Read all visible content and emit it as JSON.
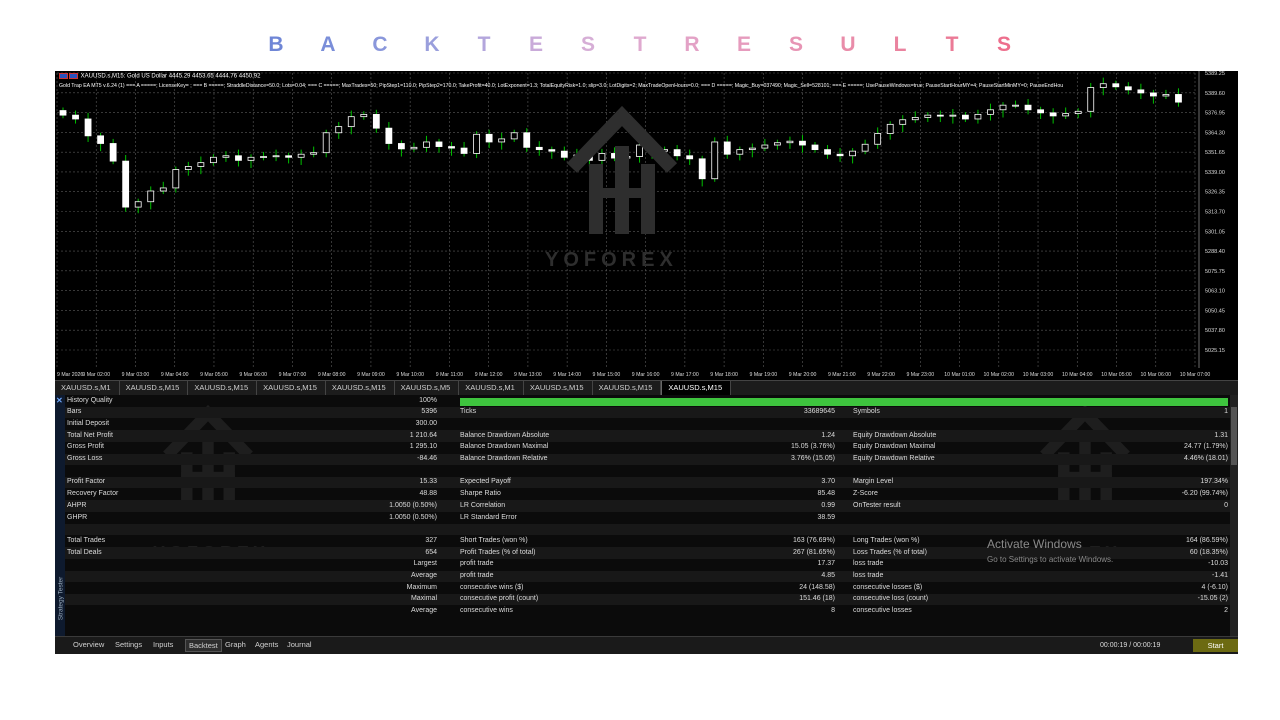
{
  "page_title_letters": [
    "B",
    "A",
    "C",
    "K",
    "T",
    "E",
    "S",
    "T",
    "R",
    "E",
    "S",
    "U",
    "L",
    "T",
    "S"
  ],
  "page_title_colors": [
    "#6f86d6",
    "#7a8ed9",
    "#8a97db",
    "#9a9fdc",
    "#b3a6dc",
    "#c9aad9",
    "#d6aed6",
    "#dfa9cf",
    "#e3a2c6",
    "#e69bbd",
    "#e794b4",
    "#e98ca9",
    "#ea839f",
    "#eb7a96",
    "#ed6f8d"
  ],
  "chart": {
    "symbol_line": "XAUUSD.s,M15:  Gold US Dollar  4445.29 4453.65 4444.76 4450.92",
    "params_line": "Gold Trap EA MT5 v.6.24 (1)  ===  A  =====; LicenseKey= ; ===  B  =====; StraddleDistance=50.0; Lots=0.04; ===  C  =====; MaxTrades=50; PipStep1=110.0; PipStep2=170.0; TakeProfit=40.0; LotExponent=1.3; TotalEquityRisk=1.0; slip=3.0; LotDigits=2; MaxTradeOpenHours=0.0; ===  D  =====; Magic_Buy=037490; Magic_Sell=528101; ===  E  =====; UsePauseWindows=true; PauseStartHourMY=4; PauseStartMinMY=0; PauseEndHou",
    "watermark": "YOFOREX",
    "price_labels": [
      "5389.25",
      "5389.60",
      "5376.95",
      "5364.30",
      "5351.65",
      "5339.00",
      "5326.35",
      "5313.70",
      "5301.05",
      "5288.40",
      "5075.75",
      "5063.10",
      "5050.45",
      "5037.80",
      "5025.15"
    ],
    "time_labels": [
      "9 Mar 2026",
      "9 Mar 02:00",
      "9 Mar 03:00",
      "9 Mar 04:00",
      "9 Mar 05:00",
      "9 Mar 06:00",
      "9 Mar 07:00",
      "9 Mar 08:00",
      "9 Mar 09:00",
      "9 Mar 10:00",
      "9 Mar 11:00",
      "9 Mar 12:00",
      "9 Mar 13:00",
      "9 Mar 14:00",
      "9 Mar 15:00",
      "9 Mar 16:00",
      "9 Mar 17:00",
      "9 Mar 18:00",
      "9 Mar 19:00",
      "9 Mar 20:00",
      "9 Mar 21:00",
      "9 Mar 22:00",
      "9 Mar 23:00",
      "10 Mar 01:00",
      "10 Mar 02:00",
      "10 Mar 03:00",
      "10 Mar 04:00",
      "10 Mar 05:00",
      "10 Mar 06:00",
      "10 Mar 07:00"
    ],
    "closes": [
      5345,
      5340,
      5318,
      5308,
      5285,
      5225,
      5232,
      5246,
      5250,
      5274,
      5278,
      5283,
      5290,
      5292,
      5286,
      5290,
      5291,
      5292,
      5290,
      5294,
      5296,
      5322,
      5330,
      5343,
      5346,
      5328,
      5308,
      5301,
      5303,
      5310,
      5304,
      5302,
      5295,
      5320,
      5310,
      5314,
      5322,
      5303,
      5300,
      5298,
      5290,
      5293,
      5286,
      5295,
      5289,
      5291,
      5306,
      5298,
      5300,
      5292,
      5288,
      5262,
      5310,
      5294,
      5300,
      5302,
      5306,
      5309,
      5311,
      5306,
      5300,
      5294,
      5292,
      5298,
      5307,
      5321,
      5333,
      5339,
      5342,
      5345,
      5344,
      5345,
      5340,
      5346,
      5352,
      5358,
      5358,
      5352,
      5348,
      5344,
      5347,
      5350,
      5381,
      5386,
      5382,
      5378,
      5374,
      5370,
      5372,
      5362
    ]
  },
  "chart_tabs": [
    "XAUUSD.s,M1",
    "XAUUSD.s,M15",
    "XAUUSD.s,M15",
    "XAUUSD.s,M15",
    "XAUUSD.s,M15",
    "XAUUSD.s,M5",
    "XAUUSD.s,M1",
    "XAUUSD.s,M15",
    "XAUUSD.s,M15",
    "XAUUSD.s,M15"
  ],
  "report": {
    "rows": [
      {
        "l1": "History Quality",
        "v1": "100%",
        "l2": "",
        "v2": "",
        "l3": "",
        "v3": ""
      },
      {
        "l1": "Bars",
        "v1": "5396",
        "l2": "Ticks",
        "v2": "33689645",
        "l3": "Symbols",
        "v3": "1"
      },
      {
        "l1": "Initial Deposit",
        "v1": "300.00",
        "l2": "",
        "v2": "",
        "l3": "",
        "v3": ""
      },
      {
        "l1": "Total Net Profit",
        "v1": "1 210.64",
        "l2": "Balance Drawdown Absolute",
        "v2": "1.24",
        "l3": "Equity Drawdown Absolute",
        "v3": "1.31"
      },
      {
        "l1": "Gross Profit",
        "v1": "1 295.10",
        "l2": "Balance Drawdown Maximal",
        "v2": "15.05 (3.76%)",
        "l3": "Equity Drawdown Maximal",
        "v3": "24.77 (1.79%)"
      },
      {
        "l1": "Gross Loss",
        "v1": "-84.46",
        "l2": "Balance Drawdown Relative",
        "v2": "3.76% (15.05)",
        "l3": "Equity Drawdown Relative",
        "v3": "4.46% (18.01)"
      },
      {
        "l1": "",
        "v1": "",
        "l2": "",
        "v2": "",
        "l3": "",
        "v3": ""
      },
      {
        "l1": "Profit Factor",
        "v1": "15.33",
        "l2": "Expected Payoff",
        "v2": "3.70",
        "l3": "Margin Level",
        "v3": "197.34%"
      },
      {
        "l1": "Recovery Factor",
        "v1": "48.88",
        "l2": "Sharpe Ratio",
        "v2": "85.48",
        "l3": "Z-Score",
        "v3": "-6.20 (99.74%)"
      },
      {
        "l1": "AHPR",
        "v1": "1.0050 (0.50%)",
        "l2": "LR Correlation",
        "v2": "0.99",
        "l3": "OnTester result",
        "v3": "0"
      },
      {
        "l1": "GHPR",
        "v1": "1.0050 (0.50%)",
        "l2": "LR Standard Error",
        "v2": "38.59",
        "l3": "",
        "v3": ""
      },
      {
        "l1": "",
        "v1": "",
        "l2": "",
        "v2": "",
        "l3": "",
        "v3": ""
      },
      {
        "l1": "Total Trades",
        "v1": "327",
        "l2": "Short Trades (won %)",
        "v2": "163 (76.69%)",
        "l3": "Long Trades (won %)",
        "v3": "164 (86.59%)"
      },
      {
        "l1": "Total Deals",
        "v1": "654",
        "l2": "Profit Trades (% of total)",
        "v2": "267 (81.65%)",
        "l3": "Loss Trades (% of total)",
        "v3": "60 (18.35%)"
      },
      {
        "l1": "",
        "v1": "Largest",
        "l2": "profit trade",
        "v2": "17.37",
        "l3": "loss trade",
        "v3": "-10.03"
      },
      {
        "l1": "",
        "v1": "Average",
        "l2": "profit trade",
        "v2": "4.85",
        "l3": "loss trade",
        "v3": "-1.41"
      },
      {
        "l1": "",
        "v1": "Maximum",
        "l2": "consecutive wins ($)",
        "v2": "24 (148.58)",
        "l3": "consecutive losses ($)",
        "v3": "4 (-6.10)"
      },
      {
        "l1": "",
        "v1": "Maximal",
        "l2": "consecutive profit (count)",
        "v2": "151.46 (18)",
        "l3": "consecutive loss (count)",
        "v3": "-15.05 (2)"
      },
      {
        "l1": "",
        "v1": "Average",
        "l2": "consecutive wins",
        "v2": "8",
        "l3": "consecutive losses",
        "v3": "2"
      }
    ],
    "history_quality_progress": 1.0,
    "side_label": "Strategy Tester",
    "watermark": "YOFOREX"
  },
  "bottom_tabs": [
    "Overview",
    "Settings",
    "Inputs",
    "Backtest",
    "Graph",
    "Agents",
    "Journal"
  ],
  "active_bottom_tab": "Backtest",
  "timer": "00:00:19 / 00:00:19",
  "start_label": "Start",
  "activate": {
    "line1": "Activate Windows",
    "line2": "Go to Settings to activate Windows."
  },
  "colors": {
    "bull": "#ffffff",
    "bear": "#ffffff",
    "wick": "#00c000",
    "grid": "#5a5a5a",
    "progress": "#3ec43e",
    "start": "#6c6a12"
  }
}
